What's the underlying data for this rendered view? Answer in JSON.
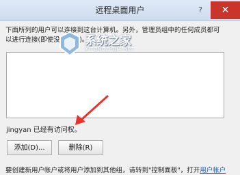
{
  "window": {
    "title": "远程桌面用户",
    "help_glyph": "?",
    "close_glyph": "✕"
  },
  "description": "下面所列的用户可以连接到这台计算机。另外，管理员组中的任何成员都可以进行连接(即使没有列出)。",
  "list": {
    "items": []
  },
  "status": "jingyan 已经有访问权。",
  "buttons": {
    "add": "添加(D)...",
    "remove": "删除(R)"
  },
  "footer": {
    "text": "要创建新用户帐户或将用户添加到其他组，请转到\"控制面板\"，打开",
    "link": "用户帐户"
  },
  "watermark": {
    "main": "系统之家",
    "sub": "XITONGZHIJIA.NET"
  },
  "colors": {
    "accent_close": "#c9342b",
    "link": "#1a5fbd",
    "arrow": "#e8322a"
  }
}
